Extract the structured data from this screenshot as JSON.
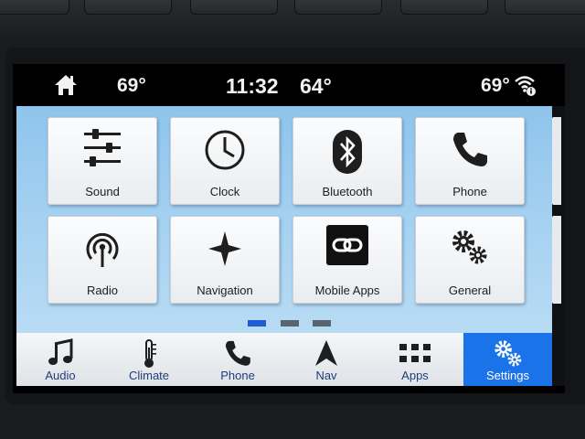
{
  "status": {
    "left_temp": "69°",
    "time": "11:32",
    "outside_temp": "64°",
    "right_temp": "69°"
  },
  "tiles": [
    {
      "label": "Sound",
      "icon": "sliders-icon"
    },
    {
      "label": "Clock",
      "icon": "clock-icon"
    },
    {
      "label": "Bluetooth",
      "icon": "bluetooth-icon"
    },
    {
      "label": "Phone",
      "icon": "phone-icon"
    },
    {
      "label": "Radio",
      "icon": "radio-icon"
    },
    {
      "label": "Navigation",
      "icon": "compass-star-icon"
    },
    {
      "label": "Mobile Apps",
      "icon": "link-icon"
    },
    {
      "label": "General",
      "icon": "gears-icon"
    }
  ],
  "pagination": {
    "pages": 3,
    "current": 1
  },
  "bottom_nav": [
    {
      "label": "Audio",
      "icon": "music-note-icon"
    },
    {
      "label": "Climate",
      "icon": "thermometer-icon"
    },
    {
      "label": "Phone",
      "icon": "phone-icon"
    },
    {
      "label": "Nav",
      "icon": "nav-arrow-icon"
    },
    {
      "label": "Apps",
      "icon": "apps-grid-icon"
    },
    {
      "label": "Settings",
      "icon": "gears-icon",
      "active": true
    }
  ],
  "colors": {
    "accent": "#1a73e8",
    "page_dot_active": "#1f5bd1",
    "screen_bg": "#a9d3f2"
  }
}
